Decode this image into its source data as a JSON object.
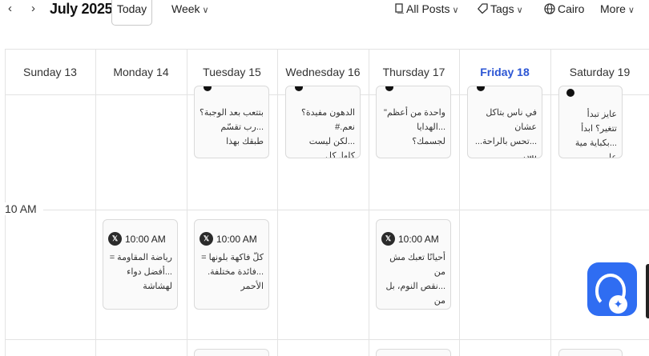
{
  "toolbar": {
    "prev_icon": "chevron-left-icon",
    "prev_glyph": "‹",
    "next_icon": "chevron-right-icon",
    "next_glyph": "›",
    "month": "July 2025",
    "today": "Today",
    "view": "Week",
    "posts_filter": "All Posts",
    "tags_filter": "Tags",
    "timezone": "Cairo",
    "more": "More",
    "caret": "∨"
  },
  "days": [
    {
      "label": "Sunday  13",
      "active": false
    },
    {
      "label": "Monday  14",
      "active": false
    },
    {
      "label": "Tuesday  15",
      "active": false
    },
    {
      "label": "Wednesday  16",
      "active": false
    },
    {
      "label": "Thursday  17",
      "active": false
    },
    {
      "label": "Friday  18",
      "active": true
    },
    {
      "label": "Saturday  19",
      "active": false
    }
  ],
  "hour_label": "10 AM",
  "top_cards": [
    {
      "day": "Tuesday",
      "line1": "بتتعب بعد الوجبة؟",
      "line2": "...رب تقسّم طبقك بهذا"
    },
    {
      "day": "Wednesday",
      "line1": "الدهون مفيدة؟ نعم.#",
      "line2": "...لكن ليست كلها. كل"
    },
    {
      "day": "Thursday",
      "line1": "واحدة من أعظم\"",
      "line2": "...الهدايا لجسمك؟"
    },
    {
      "day": "Friday",
      "line1": "في ناس بتاكل عشان",
      "line2": "...تحس بالراحة... بس"
    },
    {
      "day": "Saturday",
      "line1": "عايز تبدأ تتغير؟ ابدأ",
      "line2": "...بكباية مية على"
    }
  ],
  "posts": [
    {
      "day": "Monday",
      "time": "10:00 AM",
      "network_icon": "x-logo-icon",
      "network_glyph": "𝕏",
      "line1": "رياضة المقاومة =",
      "line2": "...أفضل دواء لهشاشة"
    },
    {
      "day": "Tuesday",
      "time": "10:00 AM",
      "network_icon": "x-logo-icon",
      "network_glyph": "𝕏",
      "line1": "كلّ فاكهة بلونها =",
      "line2": "...فائدة مختلفة. الأحمر"
    },
    {
      "day": "Thursday",
      "time": "10:00 AM",
      "network_icon": "x-logo-icon",
      "network_glyph": "𝕏",
      "line1": "أحيانًا تعبك مش من",
      "line2": "...نقص النوم، بل من"
    }
  ],
  "assistant": {
    "icon": "ai-assistant-icon",
    "spark_glyph": "✦"
  },
  "colors": {
    "accent": "#2b55d4",
    "fab": "#2f6df2",
    "grid": "#e3e3e3"
  }
}
